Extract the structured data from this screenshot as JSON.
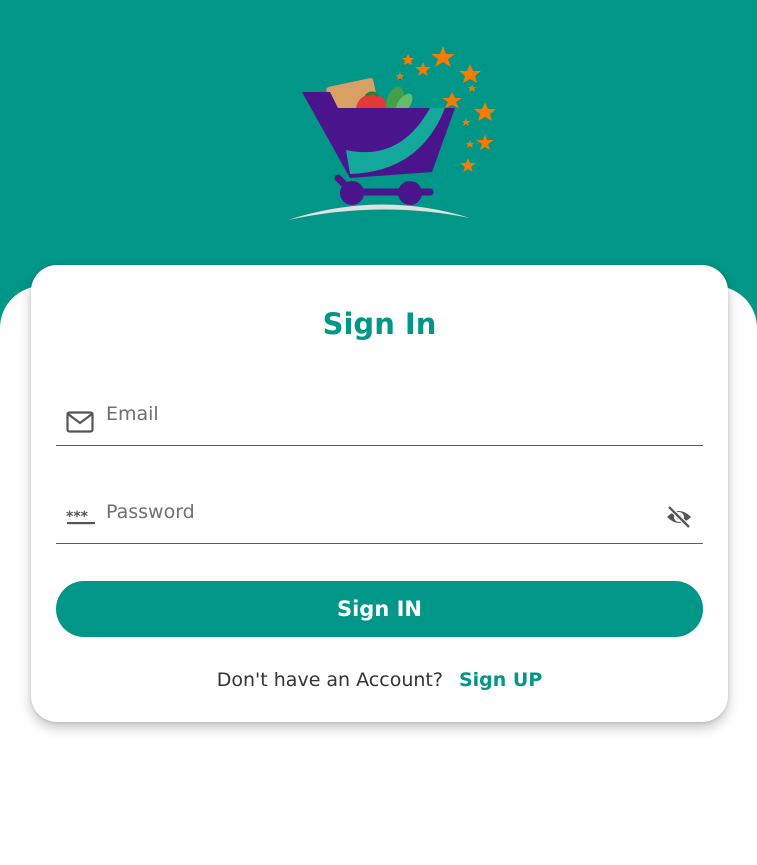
{
  "colors": {
    "primary": "#009688",
    "background": "#ffffff",
    "cart": "#4a148c",
    "stars": "#f57c00"
  },
  "logo": {
    "icon": "shopping-cart-logo"
  },
  "form": {
    "title": "Sign In",
    "email": {
      "placeholder": "Email",
      "icon": "mail-icon"
    },
    "password": {
      "placeholder": "Password",
      "icon": "password-icon",
      "toggle_icon": "visibility-off-icon"
    },
    "submit_label": "Sign IN",
    "signup_prompt": "Don't have an Account?",
    "signup_link": "Sign UP"
  }
}
